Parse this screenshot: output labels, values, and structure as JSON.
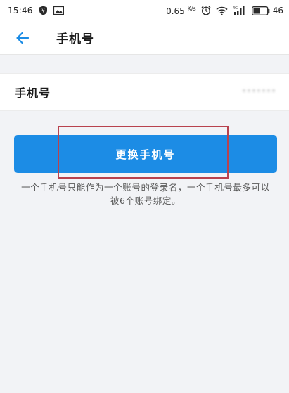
{
  "status_bar": {
    "time": "15:46",
    "network_speed": "0.65",
    "network_speed_unit": "K/s",
    "battery": "46",
    "icons": [
      "shield-app-icon",
      "image-icon",
      "alarm-icon",
      "wifi-icon",
      "signal-4g-icon",
      "battery-icon"
    ]
  },
  "header": {
    "title": "手机号"
  },
  "phone": {
    "label": "手机号",
    "value": "*******"
  },
  "actions": {
    "change_button_label": "更换手机号"
  },
  "info": {
    "note": "一个手机号只能作为一个账号的登录名，一个手机号最多可以被6个账号绑定。"
  },
  "colors": {
    "accent": "#1c8ce5",
    "highlight": "#b8424e",
    "background": "#f2f3f6"
  }
}
